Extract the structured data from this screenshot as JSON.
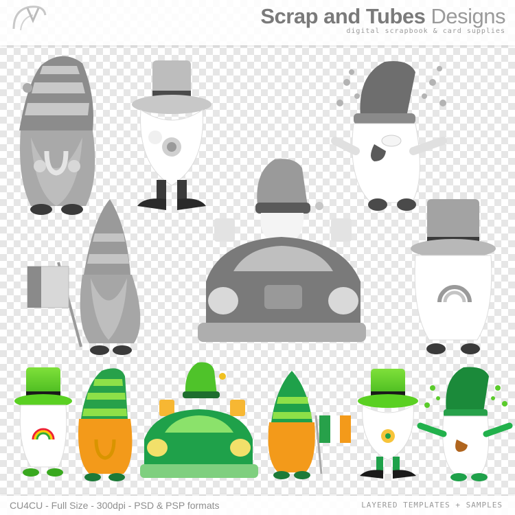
{
  "header": {
    "brand_bold": "Scrap and Tubes",
    "brand_light": "Designs",
    "tagline": "digital scrapbook & card supplies"
  },
  "footer": {
    "left_text": "CU4CU - Full Size - 300dpi - PSD & PSP formats",
    "right_text": "LAYERED TEMPLATES + SAMPLES"
  },
  "colors": {
    "checker": "#e6e6e6",
    "gray_dark": "#5a5a5a",
    "gray_mid": "#9a9a9a",
    "gray_light": "#cfcfcf",
    "green_bright": "#6cd42a",
    "green_dark": "#1a8a3a",
    "orange_beard": "#f39a1a"
  },
  "icons": [
    "logo-swirl-icon",
    "gnome-figure",
    "car-figure",
    "flag-figure",
    "shamrock-icon",
    "horseshoe-icon",
    "beer-mug-icon",
    "rainbow-icon",
    "pipe-icon"
  ]
}
